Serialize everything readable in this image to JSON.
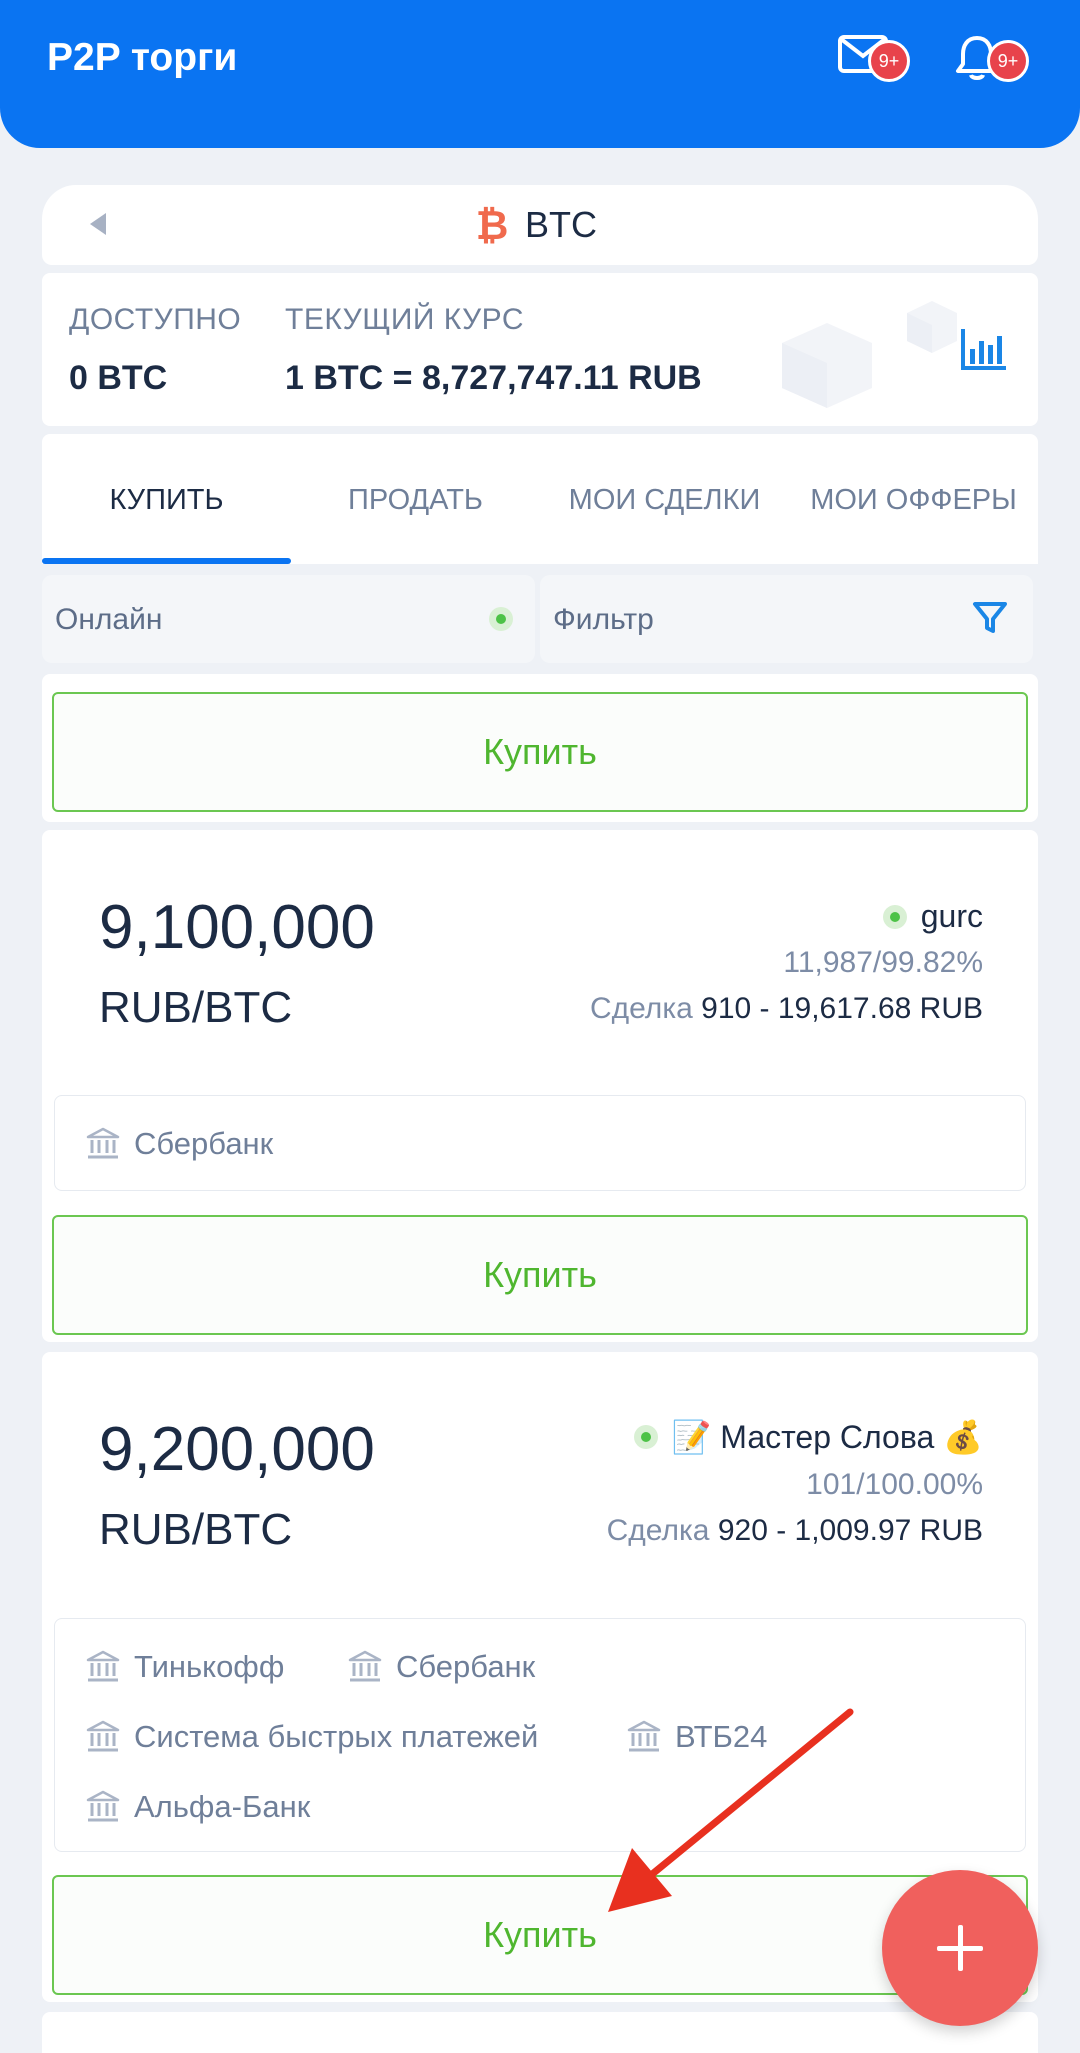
{
  "header": {
    "title": "P2P торги",
    "messages_badge": "9+",
    "notifications_badge": "9+"
  },
  "coin": {
    "symbol": "BTC",
    "icon": "bitcoin-icon",
    "icon_color": "#f06a4d"
  },
  "rate": {
    "available_label": "ДОСТУПНО",
    "available_value": "0 BTC",
    "current_label": "ТЕКУЩИЙ КУРС",
    "current_value": "1 BTC = 8,727,747.11 RUB"
  },
  "tabs": [
    {
      "label": "КУПИТЬ",
      "active": true
    },
    {
      "label": "ПРОДАТЬ",
      "active": false
    },
    {
      "label": "МОИ СДЕЛКИ",
      "active": false
    },
    {
      "label": "МОИ ОФФЕРЫ",
      "active": false
    }
  ],
  "filters": {
    "online_label": "Онлайн",
    "filter_label": "Фильтр"
  },
  "buy_label": "Купить",
  "offers": [
    {
      "price": "9,100,000",
      "pair": "RUB/BTC",
      "seller": "gurc",
      "stats": "11,987/99.82%",
      "deal_label": "Сделка",
      "deal_range": "910 - 19,617.68 RUB",
      "payments": [
        "Сбербанк"
      ]
    },
    {
      "price": "9,200,000",
      "pair": "RUB/BTC",
      "seller": "📝 Мастер Слова 💰",
      "stats": "101/100.00%",
      "deal_label": "Сделка",
      "deal_range": "920 - 1,009.97 RUB",
      "payments": [
        "Тинькофф",
        "Сбербанк",
        "Система быстрых платежей",
        "ВТБ24",
        "Альфа-Банк"
      ]
    }
  ],
  "colors": {
    "brand_blue": "#0a74f2",
    "buy_green": "#4fb62f",
    "fab_red": "#f0605d",
    "online_green": "#4dc247"
  }
}
